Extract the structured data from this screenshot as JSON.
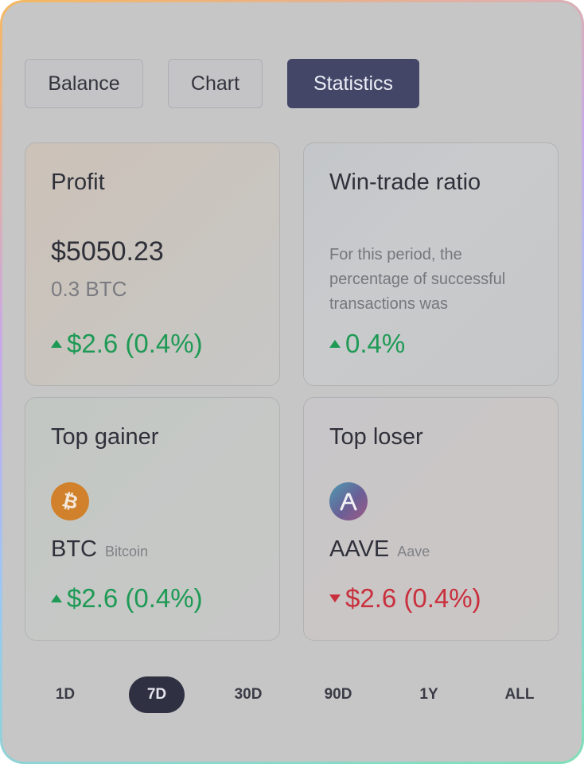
{
  "tabs": [
    {
      "label": "Balance"
    },
    {
      "label": "Chart"
    },
    {
      "label": "Statistics",
      "active": true
    }
  ],
  "cards": {
    "profit": {
      "title": "Profit",
      "amount": "$5050.23",
      "sub": "0.3 BTC",
      "change": "$2.6 (0.4%)",
      "direction": "up"
    },
    "ratio": {
      "title": "Win-trade ratio",
      "description": "For this period, the percentage of successful transactions was",
      "change": "0.4%",
      "direction": "up"
    },
    "gainer": {
      "title": "Top gainer",
      "icon": "bitcoin-icon",
      "symbol": "BTC",
      "name": "Bitcoin",
      "change": "$2.6 (0.4%)",
      "direction": "up"
    },
    "loser": {
      "title": "Top loser",
      "icon": "aave-icon",
      "symbol": "AAVE",
      "name": "Aave",
      "change": "$2.6 (0.4%)",
      "direction": "down"
    }
  },
  "periods": [
    {
      "label": "1D"
    },
    {
      "label": "7D",
      "active": true
    },
    {
      "label": "30D"
    },
    {
      "label": "90D"
    },
    {
      "label": "1Y"
    },
    {
      "label": "ALL"
    }
  ],
  "colors": {
    "positive": "#1e9a55",
    "negative": "#c9303d",
    "active_tab": "#434667",
    "active_period": "#2f3142",
    "bitcoin": "#d1812b"
  }
}
